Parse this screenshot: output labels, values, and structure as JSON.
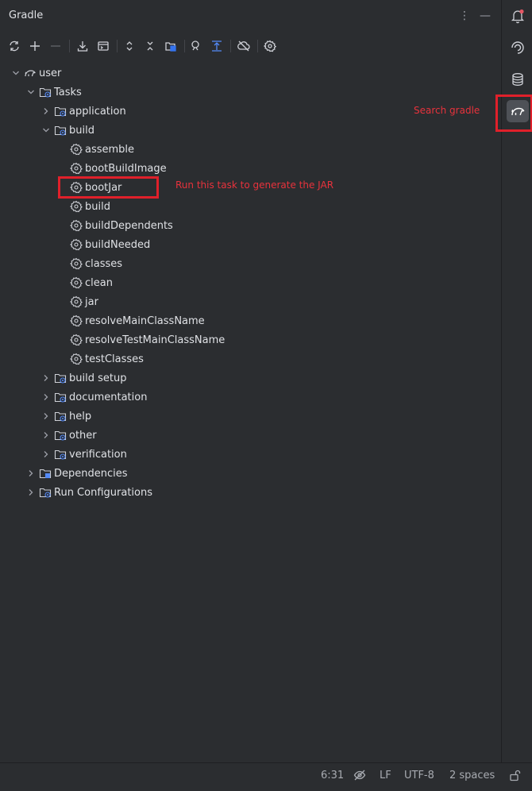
{
  "panel": {
    "title": "Gradle"
  },
  "tree": {
    "root": "user",
    "tasks": "Tasks",
    "groups": {
      "application": "application",
      "build": "build",
      "build_setup": "build setup",
      "documentation": "documentation",
      "help": "help",
      "other": "other",
      "verification": "verification"
    },
    "build_tasks": [
      "assemble",
      "bootBuildImage",
      "bootJar",
      "build",
      "buildDependents",
      "buildNeeded",
      "classes",
      "clean",
      "jar",
      "resolveMainClassName",
      "resolveTestMainClassName",
      "testClasses"
    ],
    "dependencies": "Dependencies",
    "run_configurations": "Run Configurations"
  },
  "annotations": {
    "bootjar_note": "Run this task to generate the JAR",
    "search_note": "Search gradle"
  },
  "statusbar": {
    "position": "6:31",
    "line_separator": "LF",
    "encoding": "UTF-8",
    "indent": "2 spaces"
  },
  "colors": {
    "background": "#2b2d30",
    "text": "#dfe1e5",
    "annotation": "#e8323c",
    "folder_accent": "#3574f0",
    "notification_dot": "#e55765"
  },
  "icons": {
    "toolbar": [
      "refresh-icon",
      "add-icon",
      "remove-icon",
      "download-sources-icon",
      "run-task-icon",
      "expand-all-icon",
      "collapse-all-icon",
      "link-project-icon",
      "analyze-dependencies-icon",
      "show-toolbar-icon",
      "offline-mode-icon",
      "settings-icon"
    ],
    "rightbar": [
      "notifications-icon",
      "ai-assistant-icon",
      "database-icon",
      "gradle-elephant-icon"
    ]
  }
}
